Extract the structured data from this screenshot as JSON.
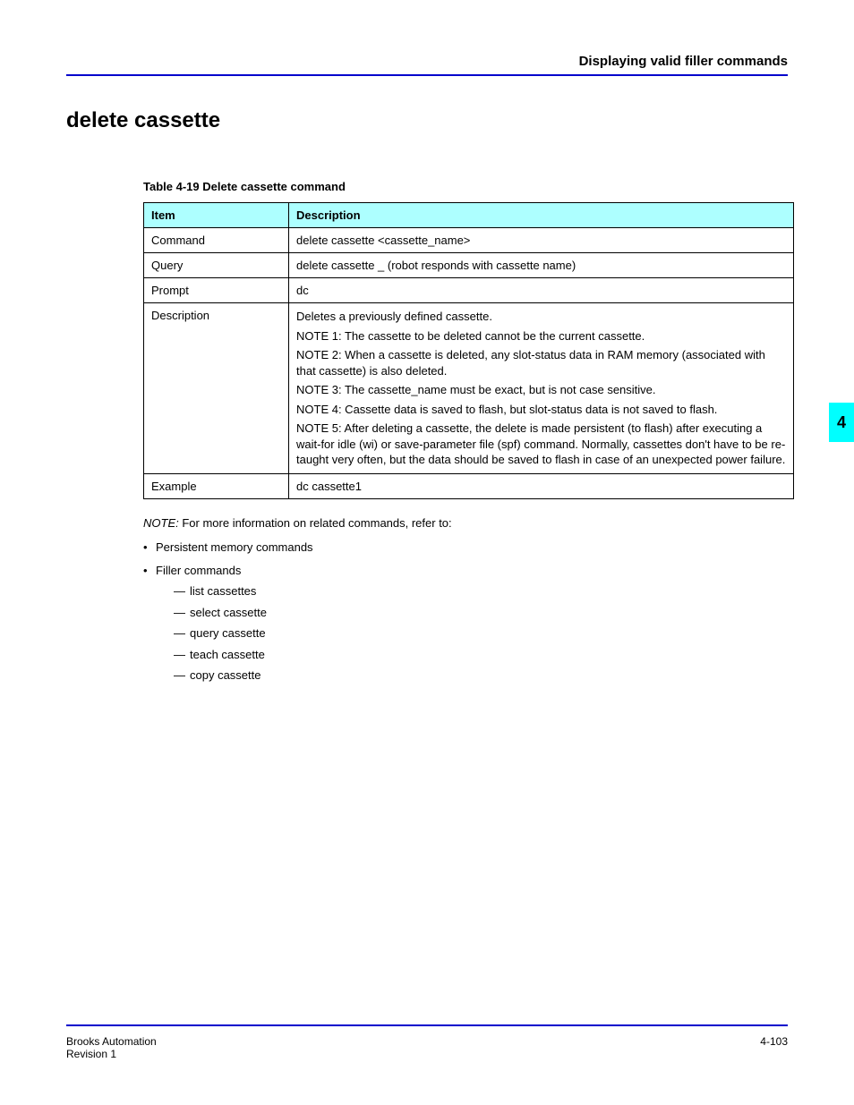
{
  "header": {
    "title": "Displaying valid filler commands"
  },
  "section": {
    "heading": "delete cassette"
  },
  "table": {
    "caption": "Table 4-19   Delete cassette command",
    "headers": [
      "Item",
      "Description"
    ],
    "rows": [
      {
        "item": "Command",
        "desc": "delete cassette <cassette_name>"
      },
      {
        "item": "Query",
        "desc": "delete cassette _  (robot responds with cassette name)"
      },
      {
        "item": "Prompt",
        "desc": "dc"
      },
      {
        "item": "Description",
        "desc_list": [
          "Deletes a previously defined cassette.",
          "NOTE 1: The cassette to be deleted cannot be the current cassette.",
          "NOTE 2: When a cassette is deleted, any slot-status data in RAM memory (associated with that cassette) is also deleted.",
          "NOTE 3: The cassette_name must be exact, but is not case sensitive.",
          "NOTE 4: Cassette data is saved to flash, but slot-status data is not saved to flash.",
          "NOTE 5: After deleting a cassette, the delete is made persistent (to flash) after executing a wait-for idle (wi) or save-parameter file (spf) command. Normally, cassettes don't have to be re-taught very often, but the data should be saved to flash in case of an unexpected power failure."
        ]
      },
      {
        "item": "Example",
        "desc": "dc cassette1"
      }
    ]
  },
  "related_note": {
    "label": "NOTE:",
    "text": "For more information on related commands, refer to:"
  },
  "related_list": [
    {
      "bullet": "•",
      "text": "Persistent memory commands"
    },
    {
      "bullet": "•",
      "text": "Filler commands",
      "sub": [
        {
          "dash": "—",
          "text": "list cassettes"
        },
        {
          "dash": "—",
          "text": "select cassette"
        },
        {
          "dash": "—",
          "text": "query cassette"
        },
        {
          "dash": "—",
          "text": "teach cassette"
        },
        {
          "dash": "—",
          "text": "copy cassette"
        }
      ]
    }
  ],
  "side_tab": "4",
  "footer": {
    "left": "Brooks Automation",
    "right": "4-103",
    "mid": "Revision 1"
  }
}
